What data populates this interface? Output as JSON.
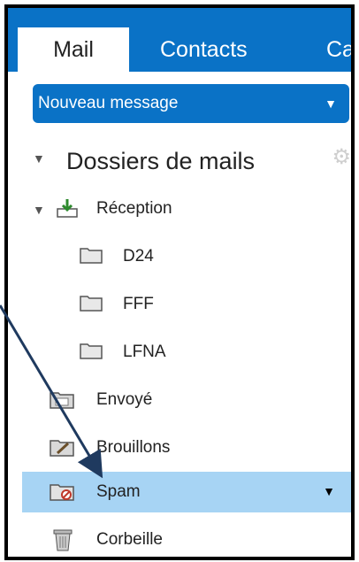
{
  "tabs": [
    {
      "label": "Mail",
      "active": true
    },
    {
      "label": "Contacts",
      "active": false
    },
    {
      "label": "Cal",
      "active": false
    }
  ],
  "new_message": {
    "label": "Nouveau message",
    "caret_icon": "caret-down-icon"
  },
  "folders_header": {
    "label": "Dossiers de mails",
    "expand_icon": "triangle-down-icon",
    "settings_icon": "gear-icon"
  },
  "folders": [
    {
      "label": "Réception",
      "icon": "inbox-download-icon",
      "level": 0,
      "expanded": true
    },
    {
      "label": "D24",
      "icon": "folder-icon",
      "level": 1
    },
    {
      "label": "FFF",
      "icon": "folder-icon",
      "level": 1
    },
    {
      "label": "LFNA",
      "icon": "folder-icon",
      "level": 1
    },
    {
      "label": "Envoyé",
      "icon": "sent-folder-icon",
      "level": 0
    },
    {
      "label": "Brouillons",
      "icon": "drafts-folder-icon",
      "level": 0
    },
    {
      "label": "Spam",
      "icon": "spam-folder-icon",
      "level": 0,
      "selected": true
    },
    {
      "label": "Corbeille",
      "icon": "trash-icon",
      "level": 0
    }
  ],
  "colors": {
    "accent": "#0a72c6",
    "selected": "#a7d4f4",
    "annotation_arrow": "#1f3a5f"
  }
}
